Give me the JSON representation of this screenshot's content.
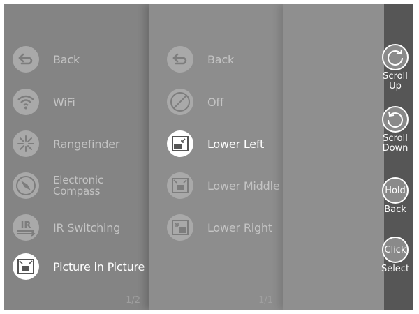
{
  "menu": {
    "items": [
      {
        "label": "Back",
        "icon": "back-arrow-icon"
      },
      {
        "label": "WiFi",
        "icon": "wifi-icon"
      },
      {
        "label": "Rangefinder",
        "icon": "rangefinder-icon"
      },
      {
        "label": "Electronic Compass",
        "icon": "compass-icon"
      },
      {
        "label": "IR Switching",
        "icon": "ir-switch-icon"
      },
      {
        "label": "Picture in Picture",
        "icon": "picture-in-picture-icon",
        "active": true
      }
    ],
    "page": "1/2"
  },
  "submenu": {
    "items": [
      {
        "label": "Back",
        "icon": "back-arrow-icon"
      },
      {
        "label": "Off",
        "icon": "off-icon"
      },
      {
        "label": "Lower Left",
        "icon": "pip-lower-left-icon",
        "active": true
      },
      {
        "label": "Lower Middle",
        "icon": "pip-lower-middle-icon"
      },
      {
        "label": "Lower Right",
        "icon": "pip-lower-right-icon"
      }
    ],
    "page": "1/1"
  },
  "controls": {
    "scroll_up": {
      "label": "Scroll Up"
    },
    "scroll_down": {
      "label": "Scroll Down"
    },
    "hold": {
      "button": "Hold",
      "label": "Back"
    },
    "click": {
      "button": "Click",
      "label": "Select"
    }
  },
  "colors": {
    "active": "#ffffff",
    "inactive_icon": "#a9a9a9",
    "sidebar": "#565656"
  }
}
